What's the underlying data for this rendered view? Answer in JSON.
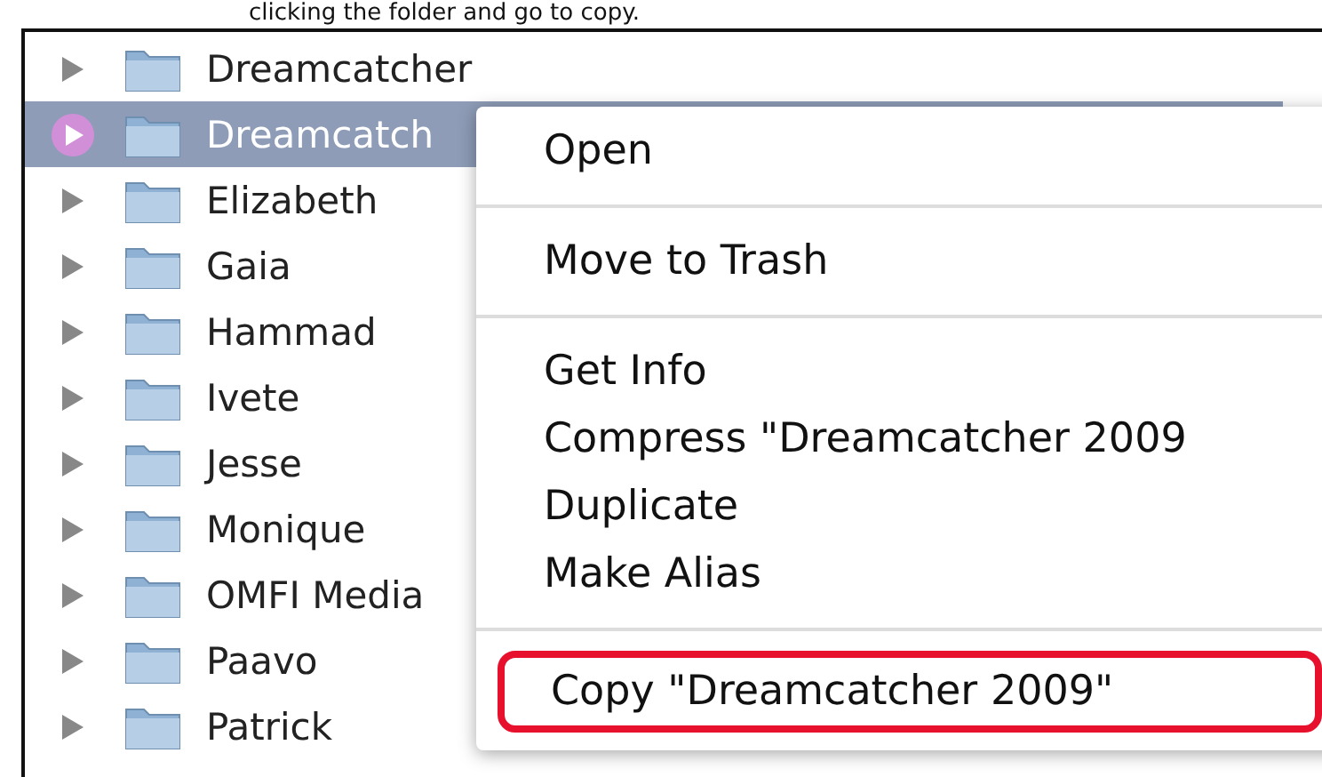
{
  "caption": "clicking the folder and go to copy.",
  "folders": [
    {
      "name": "Dreamcatcher",
      "selected": false
    },
    {
      "name": "Dreamcatch",
      "selected": true
    },
    {
      "name": "Elizabeth",
      "selected": false
    },
    {
      "name": "Gaia",
      "selected": false
    },
    {
      "name": "Hammad",
      "selected": false
    },
    {
      "name": "Ivete",
      "selected": false
    },
    {
      "name": "Jesse",
      "selected": false
    },
    {
      "name": "Monique",
      "selected": false
    },
    {
      "name": "OMFI Media",
      "selected": false
    },
    {
      "name": "Paavo",
      "selected": false
    },
    {
      "name": "Patrick",
      "selected": false
    }
  ],
  "context_menu": [
    {
      "kind": "item",
      "label": "Open",
      "highlighted": false
    },
    {
      "kind": "separator"
    },
    {
      "kind": "item",
      "label": "Move to Trash",
      "highlighted": false
    },
    {
      "kind": "separator"
    },
    {
      "kind": "item",
      "label": "Get Info",
      "highlighted": false
    },
    {
      "kind": "item",
      "label": "Compress \"Dreamcatcher 2009",
      "highlighted": false
    },
    {
      "kind": "item",
      "label": "Duplicate",
      "highlighted": false
    },
    {
      "kind": "item",
      "label": "Make Alias",
      "highlighted": false
    },
    {
      "kind": "separator"
    },
    {
      "kind": "item",
      "label": "Copy \"Dreamcatcher 2009\"",
      "highlighted": true
    }
  ]
}
